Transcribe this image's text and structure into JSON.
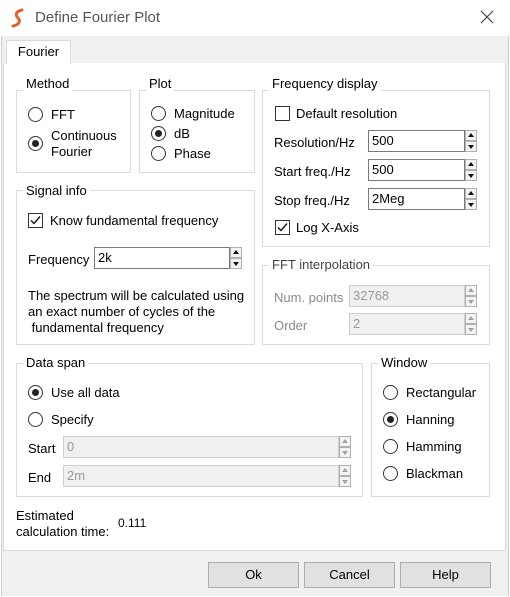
{
  "window": {
    "title": "Define Fourier Plot"
  },
  "tabs": [
    {
      "label": "Fourier"
    }
  ],
  "method": {
    "label": "Method",
    "options": [
      {
        "label": "FFT",
        "selected": false
      },
      {
        "label": "Continuous Fourier",
        "line1": "Continuous",
        "line2": "Fourier",
        "selected": true
      }
    ]
  },
  "plot": {
    "label": "Plot",
    "options": [
      {
        "label": "Magnitude",
        "selected": false
      },
      {
        "label": "dB",
        "selected": true
      },
      {
        "label": "Phase",
        "selected": false
      }
    ]
  },
  "frequency_display": {
    "label": "Frequency display",
    "default_resolution": {
      "label": "Default resolution",
      "checked": false
    },
    "resolution": {
      "label": "Resolution/Hz",
      "value": "500"
    },
    "start_freq": {
      "label": "Start freq./Hz",
      "value": "500"
    },
    "stop_freq": {
      "label": "Stop freq./Hz",
      "value": "2Meg"
    },
    "log_x_axis": {
      "label": "Log X-Axis",
      "checked": true
    }
  },
  "signal_info": {
    "label": "Signal info",
    "know_fundamental": {
      "label": "Know fundamental frequency",
      "checked": true
    },
    "frequency": {
      "label": "Frequency",
      "value": "2k"
    },
    "note": {
      "line1": "The spectrum will be calculated using",
      "line2": "an exact number of cycles of the",
      "line3": " fundamental frequency"
    }
  },
  "fft_interpolation": {
    "label": "FFT interpolation",
    "num_points": {
      "label": "Num. points",
      "value": "32768"
    },
    "order": {
      "label": "Order",
      "value": "2"
    }
  },
  "data_span": {
    "label": "Data span",
    "options": [
      {
        "label": "Use all data",
        "selected": true
      },
      {
        "label": "Specify",
        "selected": false
      }
    ],
    "start": {
      "label": "Start",
      "value": "0"
    },
    "end": {
      "label": "End",
      "value": "2m"
    }
  },
  "window_fn": {
    "label": "Window",
    "options": [
      {
        "label": "Rectangular",
        "selected": false
      },
      {
        "label": "Hanning",
        "selected": true
      },
      {
        "label": "Hamming",
        "selected": false
      },
      {
        "label": "Blackman",
        "selected": false
      }
    ]
  },
  "estimate": {
    "label_line1": "Estimated",
    "label_line2": "calculation time:",
    "value": "0.111"
  },
  "buttons": {
    "ok": "Ok",
    "cancel": "Cancel",
    "help": "Help"
  },
  "colors": {
    "logo": "#e0602a",
    "panel_bg": "#ffffff",
    "client_bg": "#f0f0f0"
  }
}
